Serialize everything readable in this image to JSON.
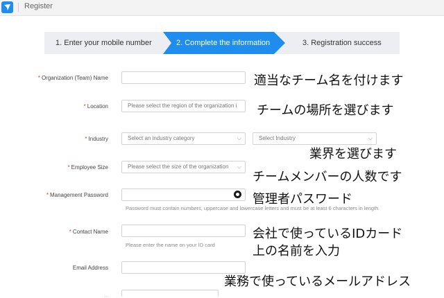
{
  "header": {
    "title": "Register"
  },
  "steps": [
    {
      "label": "1. Enter your mobile number"
    },
    {
      "label": "2. Complete the information"
    },
    {
      "label": "3. Registration success"
    }
  ],
  "form": {
    "org_name": {
      "label": "Organization (Team) Name",
      "value": ""
    },
    "location": {
      "label": "Location",
      "placeholder": "Please select the region of the organization i"
    },
    "industry": {
      "label": "Industry",
      "category_placeholder": "Select an industry category",
      "industry_placeholder": "Select Industry"
    },
    "employee_size": {
      "label": "Employee Size",
      "placeholder": "Please select the size of the organization"
    },
    "password": {
      "label": "Management Password",
      "hint": "Password must contain numbers, uppercase and lowercase letters and must be at least 6 characters in length"
    },
    "contact_name": {
      "label": "Contact Name",
      "hint": "Please enter the name on your ID card"
    },
    "email": {
      "label": "Email Address"
    },
    "partial_label": "...",
    "partial_value": "..."
  },
  "notes": {
    "org_name": "適当なチーム名を付けます",
    "location": "チームの場所を選びます",
    "industry": "業界を選びます",
    "employee_size": "チームメンバーの人数です",
    "password": "管理者パスワード",
    "contact_line1": "会社で使っているIDカード",
    "contact_line2": "上の名前を入力",
    "email": "業務で使っているメールアドレス"
  },
  "colors": {
    "accent": "#1f8ded",
    "required": "#e0342f"
  }
}
